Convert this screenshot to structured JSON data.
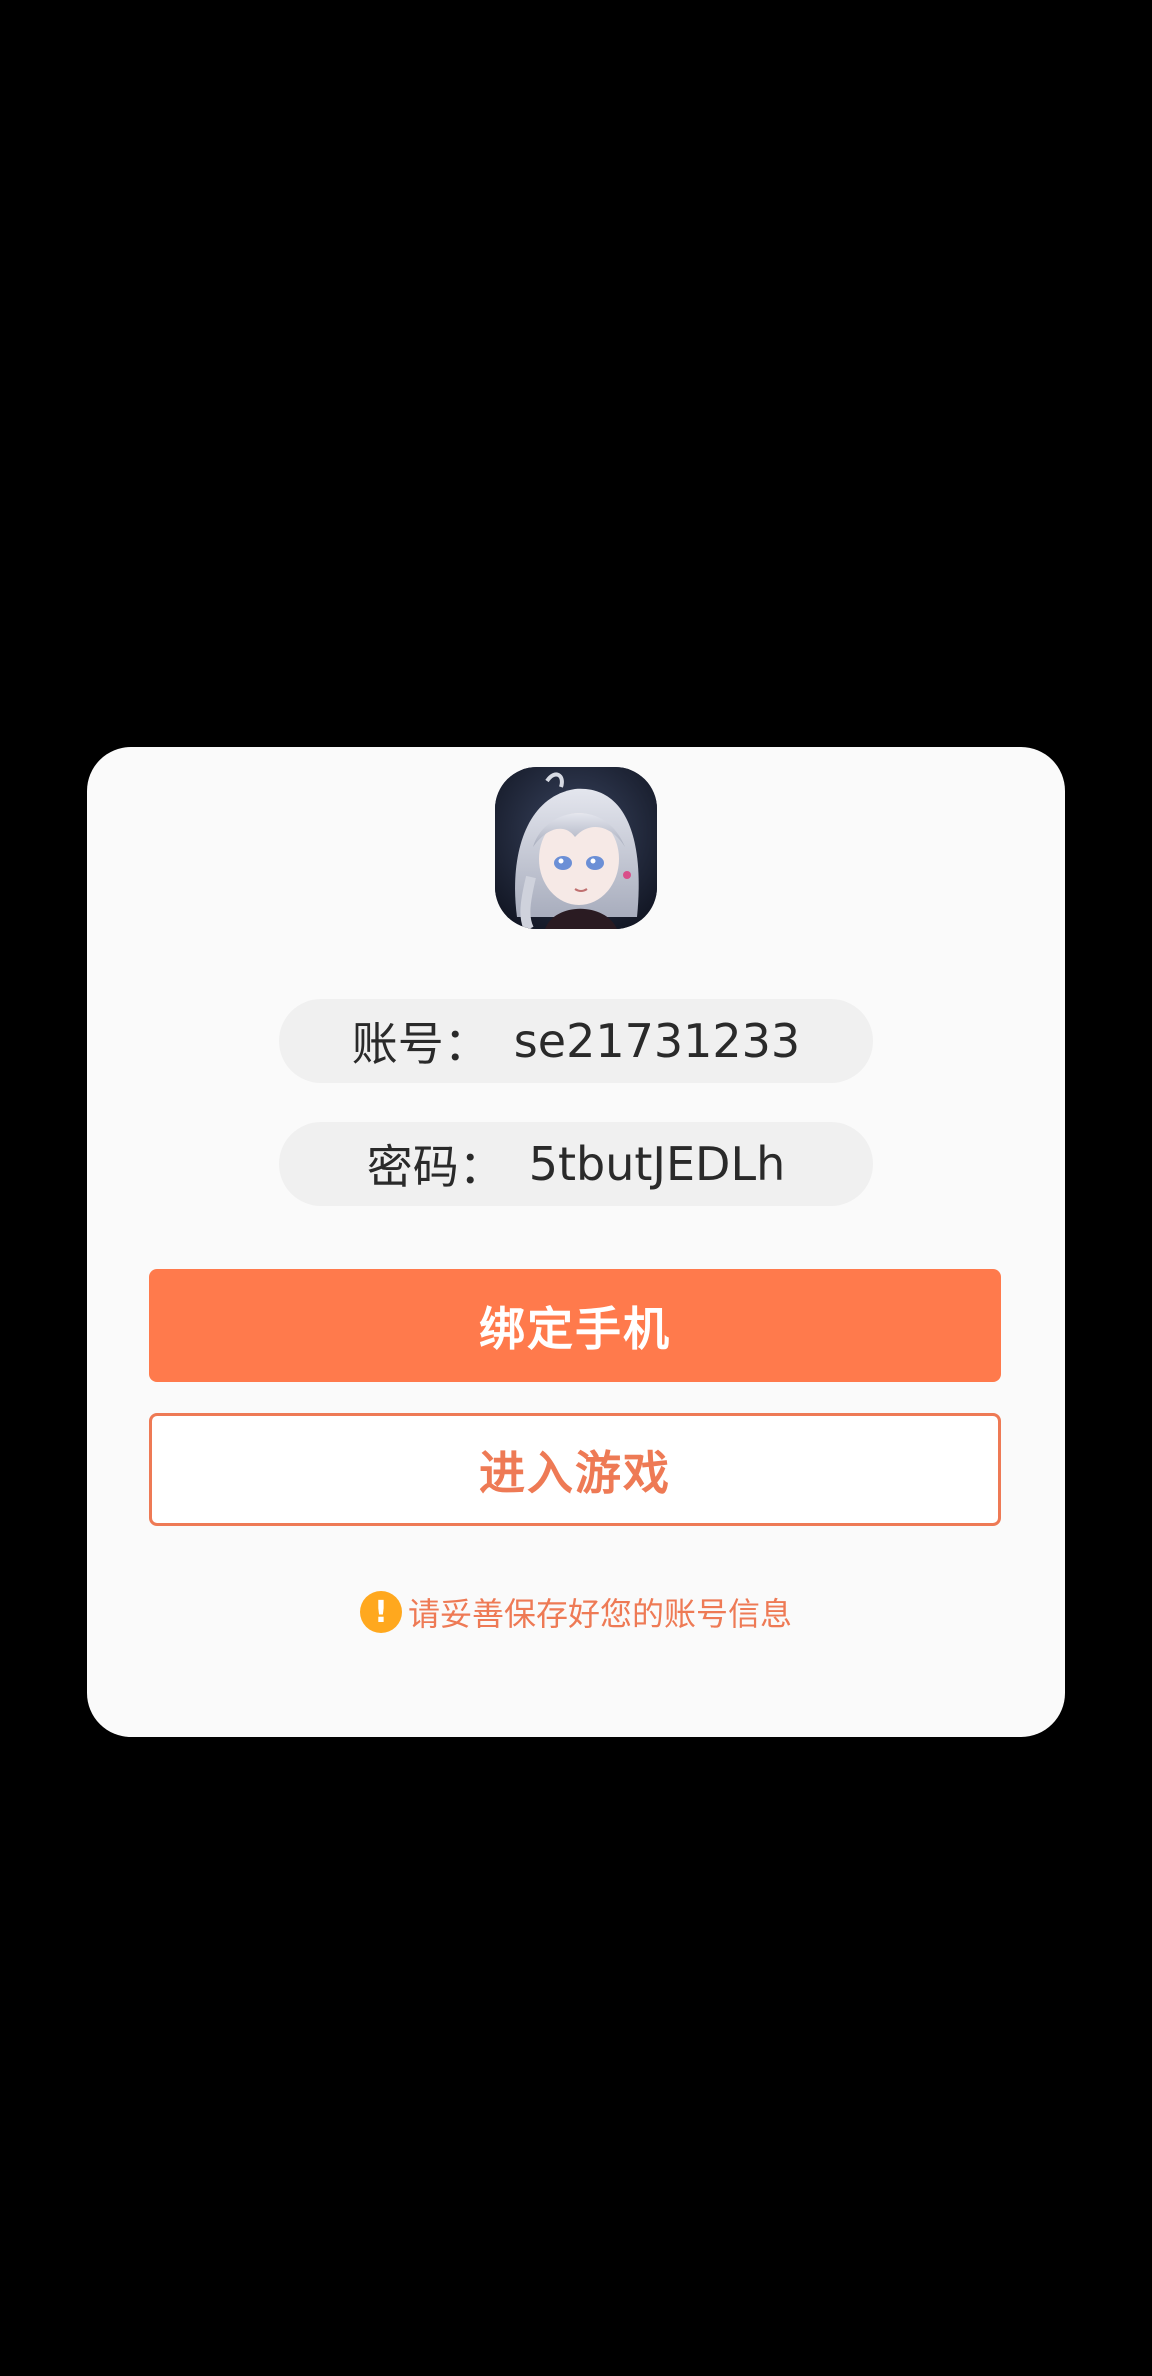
{
  "dialog": {
    "avatar_icon": "game-character-avatar",
    "account": {
      "label": "账号：",
      "value": "se21731233"
    },
    "password": {
      "label": "密码：",
      "value": "5tbutJEDLh"
    },
    "bind_phone_label": "绑定手机",
    "enter_game_label": "进入游戏",
    "notice": {
      "icon": "warning-icon",
      "icon_glyph": "!",
      "text": "请妥善保存好您的账号信息"
    }
  },
  "colors": {
    "accent": "#ff7a4c",
    "accent_text": "#ee7a55",
    "warning": "#ffa81e",
    "dialog_bg": "#fafafa",
    "field_bg": "#f0f0f0",
    "overlay_bg": "#000000"
  }
}
